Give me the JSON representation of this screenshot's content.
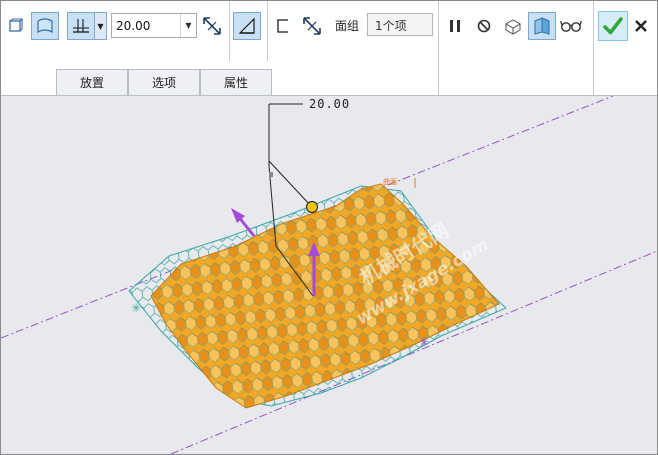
{
  "toolbar": {
    "depth_value": "20.00",
    "facegroup_label": "面组",
    "facegroup_value": "1个项"
  },
  "tabs": [
    {
      "label": "放置"
    },
    {
      "label": "选项"
    },
    {
      "label": "属性"
    }
  ],
  "viewport": {
    "dimension_text": "20.00",
    "surface_label": "曲面",
    "watermark_cn": "机械时代网",
    "watermark_url": "www.jxage.com"
  },
  "colors": {
    "surface_orange": "#f5a623",
    "mesh_teal": "#3ba7a7",
    "arrow_purple": "#a34bd6",
    "datum_line": "#9a4fd0",
    "ok_green": "#2fa83a",
    "pressed_blue": "#c9dff4"
  },
  "icons": {
    "solid": "cube-outline-icon",
    "surface": "surface-icon",
    "depth": "depth-blind-icon",
    "flip": "flip-direction-icon",
    "remove_material": "remove-material-icon",
    "thicken": "thicken-icon",
    "pause": "pause-icon",
    "stop": "no-preview-icon",
    "preview1": "geometry-preview-icon",
    "preview2": "attached-preview-icon",
    "glasses": "verify-glasses-icon",
    "ok": "checkmark-icon",
    "cancel": "close-icon"
  }
}
